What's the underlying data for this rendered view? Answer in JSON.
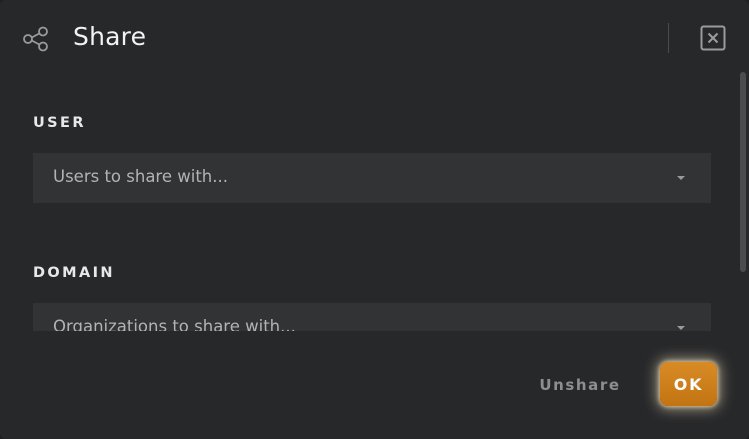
{
  "dialog": {
    "title": "Share",
    "icons": {
      "header": "share-icon",
      "close": "close-icon",
      "dropdown": "caret-down-icon"
    }
  },
  "user_section": {
    "label": "USER",
    "placeholder": "Users to share with..."
  },
  "domain_section": {
    "label": "DOMAIN",
    "placeholder": "Organizations to share with..."
  },
  "footer": {
    "unshare_label": "Unshare",
    "ok_label": "OK"
  },
  "colors": {
    "background": "#27282a",
    "field": "#323335",
    "accent": "#d88b25",
    "text": "#f2f2f2",
    "muted": "#8d8e91"
  }
}
